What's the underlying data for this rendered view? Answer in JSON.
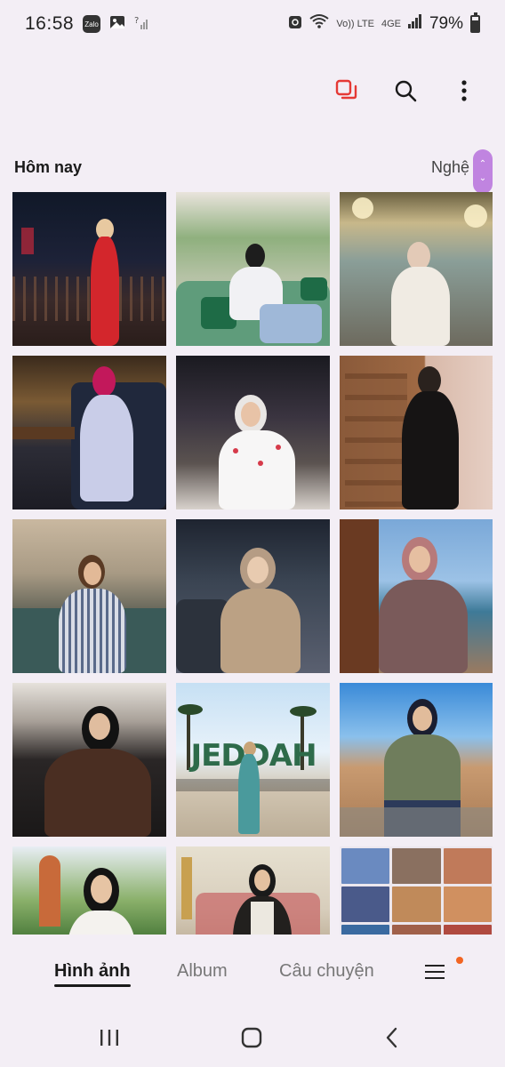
{
  "status_bar": {
    "time": "16:58",
    "battery": "79%",
    "zalo_label": "Zalo",
    "volte_label": "Vo)) LTE",
    "network_label": "4GE"
  },
  "toolbar": {
    "icons": [
      "select-icon",
      "search-icon",
      "more-options-icon"
    ],
    "accent": "#e53935"
  },
  "section": {
    "title": "Hôm nay",
    "right_label": "Nghệ A"
  },
  "tabs": [
    {
      "label": "Hình ảnh",
      "active": true
    },
    {
      "label": "Album",
      "active": false
    },
    {
      "label": "Câu chuyện",
      "active": false
    }
  ],
  "colors": {
    "background": "#f3eef5",
    "scroll_handle": "#c084e0",
    "notification_dot": "#f26522"
  },
  "photos": {
    "jeddah_sign": "JEDDAH"
  }
}
